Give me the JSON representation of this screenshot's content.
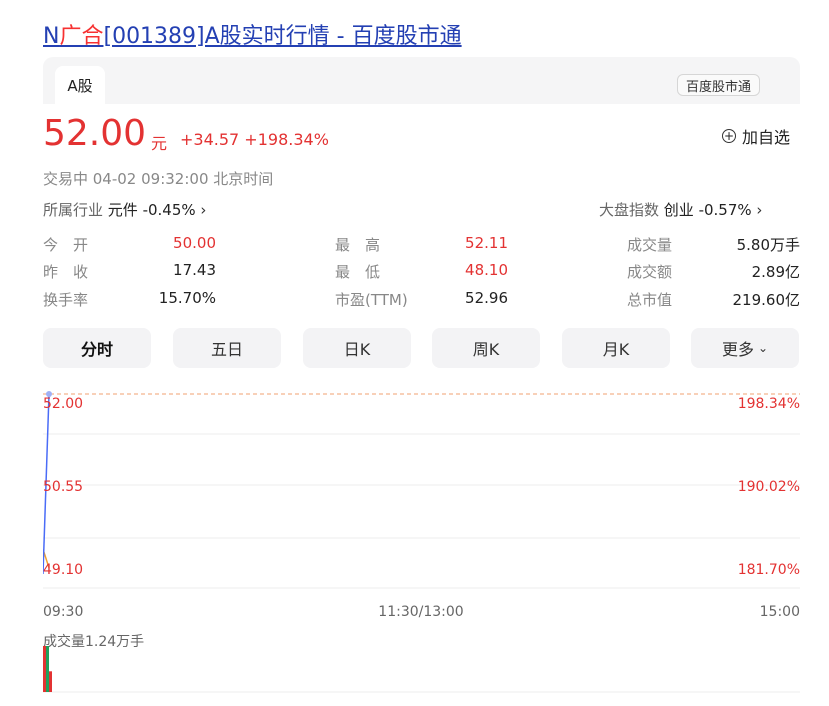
{
  "page": {
    "title_prefix": "N",
    "title_highlight": "广合",
    "title_suffix": "[001389]A股实时行情 - 百度股市通"
  },
  "tab": {
    "label": "A股",
    "source_badge": "百度股市通"
  },
  "quote": {
    "price": "52.00",
    "unit": "元",
    "change": "+34.57 +198.34%",
    "add_watchlist": "加自选",
    "status": "交易中  04-02 09:32:00  北京时间",
    "industry_label": "所属行业",
    "industry_value": "元件 -0.45%",
    "index_label": "大盘指数",
    "index_value": "创业 -0.57%"
  },
  "stats": [
    {
      "label": "今　开",
      "value": "50.00"
    },
    {
      "label": "昨　收",
      "value": "17.43"
    },
    {
      "label": "换手率",
      "value": "15.70%"
    },
    {
      "label": "最　高",
      "value": "52.11"
    },
    {
      "label": "最　低",
      "value": "48.10"
    },
    {
      "label": "市盈(TTM)",
      "value": "52.96"
    },
    {
      "label": "成交量",
      "value": "5.80万手"
    },
    {
      "label": "成交额",
      "value": "2.89亿"
    },
    {
      "label": "总市值",
      "value": "219.60亿"
    }
  ],
  "periods": [
    "分时",
    "五日",
    "日K",
    "周K",
    "月K",
    "更多"
  ],
  "chart_data": {
    "type": "line",
    "y_left_ticks": [
      "52.00",
      "50.55",
      "49.10"
    ],
    "y_right_ticks": [
      "198.34%",
      "190.02%",
      "181.70%"
    ],
    "ylim": [
      49.1,
      52.0
    ],
    "x_ticks": [
      "09:30",
      "11:30/13:00",
      "15:00"
    ],
    "series": [
      {
        "values": [
          49.1,
          52.0
        ],
        "color": "#4a6cf7"
      },
      {
        "values": [
          49.5,
          49.2
        ],
        "color": "#f0a030"
      }
    ],
    "reference_line": 52.0,
    "volume_label": "成交量1.24万手",
    "volume_bars": [
      {
        "value": 1.0,
        "color": "#e33232"
      },
      {
        "value": 1.0,
        "color": "#21a05c"
      },
      {
        "value": 0.45,
        "color": "#e33232"
      }
    ]
  },
  "colors": {
    "up": "#e33232",
    "down": "#21a05c",
    "link": "#2440b3"
  }
}
